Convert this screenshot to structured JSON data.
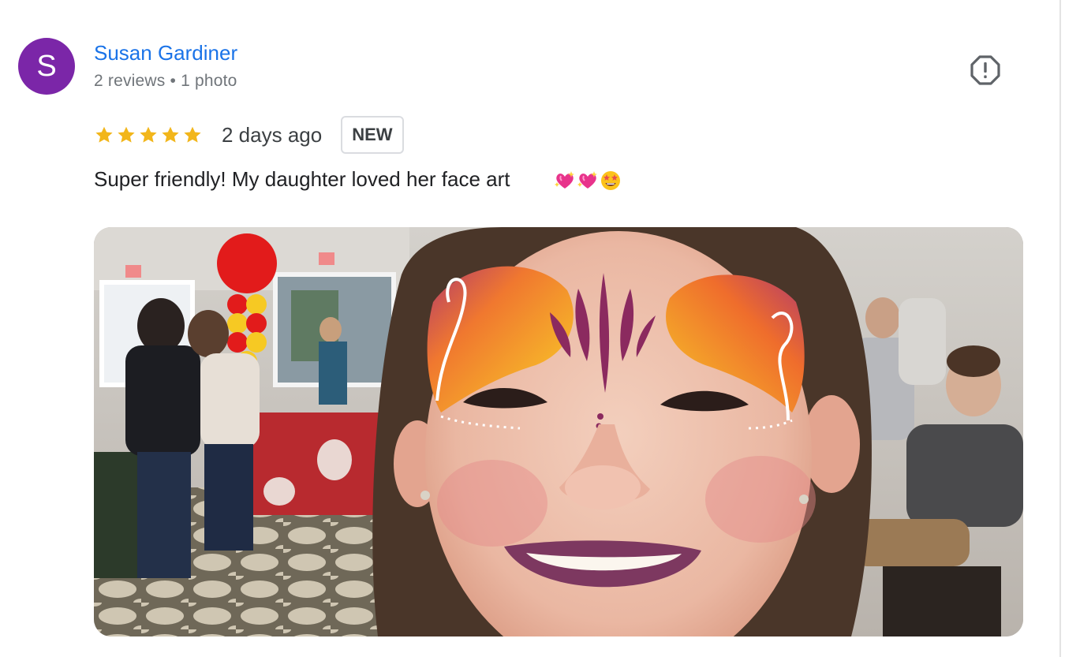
{
  "review": {
    "avatar_initial": "S",
    "avatar_color": "#7b26a8",
    "reviewer_name": "Susan Gardiner",
    "reviews_count": "2 reviews",
    "photos_count": "1 photo",
    "meta_separator": "•",
    "rating": 5,
    "rating_max": 5,
    "star_color": "#f2b61b",
    "date": "2 days ago",
    "badge": "NEW",
    "text": "Super friendly! My daughter loved her face art",
    "emojis": [
      "sparkling-heart",
      "sparkling-heart",
      "star-struck-face"
    ],
    "report_icon": "report-flag-icon",
    "photo_subject": "photo"
  },
  "colors": {
    "link": "#1a73e8",
    "meta": "#70757a",
    "body_text": "#202124"
  }
}
